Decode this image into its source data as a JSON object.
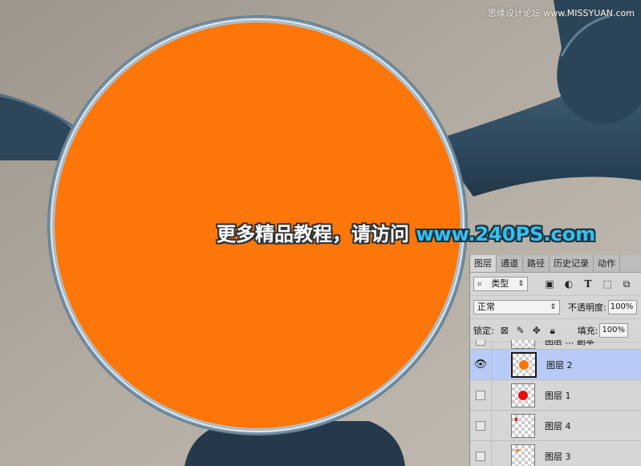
{
  "watermarks": {
    "top_right": "思缘设计论坛 www.MISSYUAN.com",
    "center_cn": "更多精品教程，请访问",
    "center_url": "www.240PS.com"
  },
  "colors": {
    "orange_fill": "#fc760a",
    "selected_row": "#b8cbf6",
    "panel_bg": "#d6d6d6"
  },
  "layers_panel": {
    "tabs": [
      {
        "label": "图层",
        "active": true
      },
      {
        "label": "通道",
        "active": false
      },
      {
        "label": "路径",
        "active": false
      },
      {
        "label": "历史记录",
        "active": false
      },
      {
        "label": "动作",
        "active": false
      }
    ],
    "filter": {
      "search_icon": "search-icon",
      "kind": "类型",
      "icons": [
        "image-filter-icon",
        "adjustment-filter-icon",
        "text-filter-icon",
        "shape-filter-icon",
        "smart-object-filter-icon"
      ]
    },
    "blend_mode": "正常",
    "opacity_label": "不透明度:",
    "opacity_value": "100%",
    "lock_label": "锁定:",
    "fill_label": "填充:",
    "fill_value": "100%",
    "layers": [
      {
        "name": "图层 … 副本",
        "visible": false,
        "selected": false,
        "thumb": "red-partial"
      },
      {
        "name": "图层 2",
        "visible": true,
        "selected": true,
        "thumb": "orange-dot"
      },
      {
        "name": "图层 1",
        "visible": false,
        "selected": false,
        "thumb": "red-dot"
      },
      {
        "name": "图层 4",
        "visible": false,
        "selected": false,
        "thumb": "red-speck"
      },
      {
        "name": "图层 3",
        "visible": false,
        "selected": false,
        "thumb": "orange-speck"
      }
    ]
  }
}
